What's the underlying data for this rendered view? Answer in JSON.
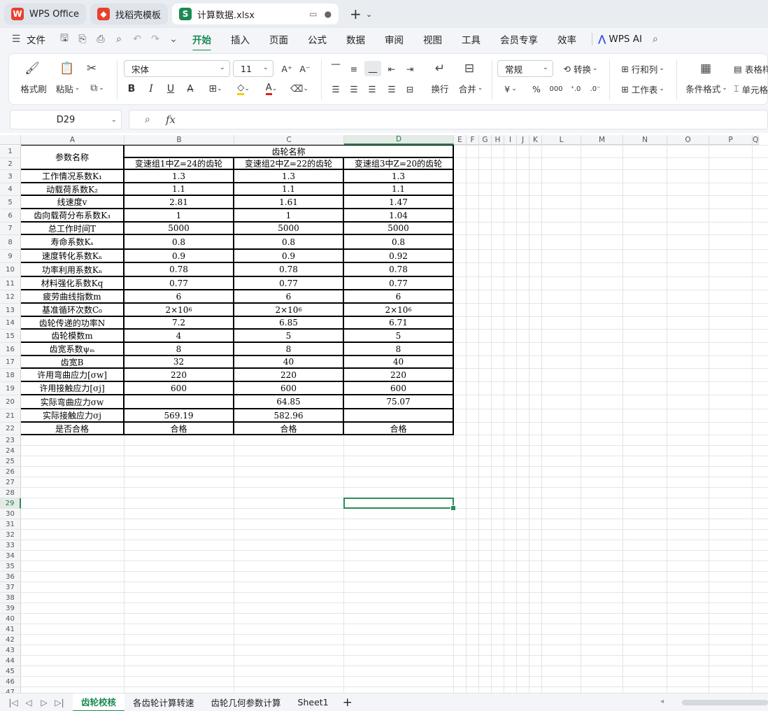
{
  "tabs": [
    {
      "label": "WPS Office",
      "icon": "wps-logo"
    },
    {
      "label": "找稻壳模板",
      "icon": "docer-logo"
    },
    {
      "label": "计算数据.xlsx",
      "icon": "spreadsheet-logo"
    }
  ],
  "menu": {
    "items": [
      "文件",
      "开始",
      "插入",
      "页面",
      "公式",
      "数据",
      "审阅",
      "视图",
      "工具",
      "会员专享",
      "效率"
    ],
    "active": "开始",
    "wps_ai": "WPS AI"
  },
  "ribbon": {
    "format_painter": "格式刷",
    "paste": "粘贴",
    "font_name": "宋体",
    "font_size": "11",
    "bold": "B",
    "italic": "I",
    "underline": "U",
    "wrap": "换行",
    "merge": "合并",
    "number_format": "常规",
    "convert": "转换",
    "row_col": "行和列",
    "worksheet": "工作表",
    "cond_format": "条件格式",
    "table_style": "表格样式",
    "cell": "单元格",
    "currency": "¥",
    "percent": "%"
  },
  "formula_bar": {
    "cell_ref": "D29",
    "fx": "fx",
    "content": ""
  },
  "columns": [
    "A",
    "B",
    "C",
    "D",
    "E",
    "F",
    "G",
    "H",
    "I",
    "J",
    "K",
    "L",
    "M",
    "N",
    "O",
    "P",
    "Q"
  ],
  "selected": {
    "col": "D",
    "row": "29"
  },
  "table": {
    "header_a": "参数名称",
    "header_group": "齿轮名称",
    "gears": [
      "变速组1中Z=24的齿轮",
      "变速组2中Z=22的齿轮",
      "变速组3中Z=20的齿轮"
    ],
    "rows": [
      {
        "name": "工作情况系数K₁",
        "b": "1.3",
        "c": "1.3",
        "d": "1.3"
      },
      {
        "name": "动载荷系数K₂",
        "b": "1.1",
        "c": "1.1",
        "d": "1.1"
      },
      {
        "name": "线速度v",
        "b": "2.81",
        "c": "1.61",
        "d": "1.47"
      },
      {
        "name": "齿向载荷分布系数K₃",
        "b": "1",
        "c": "1",
        "d": "1.04"
      },
      {
        "name": "总工作时间T",
        "b": "5000",
        "c": "5000",
        "d": "5000"
      },
      {
        "name": "寿命系数Kₛ",
        "b": "0.8",
        "c": "0.8",
        "d": "0.8"
      },
      {
        "name": "速度转化系数Kₙ",
        "b": "0.9",
        "c": "0.9",
        "d": "0.92"
      },
      {
        "name": "功率利用系数Kₙ",
        "b": "0.78",
        "c": "0.78",
        "d": "0.78"
      },
      {
        "name": "材料强化系数Kq",
        "b": "0.77",
        "c": "0.77",
        "d": "0.77"
      },
      {
        "name": "疲劳曲线指数m",
        "b": "6",
        "c": "6",
        "d": "6"
      },
      {
        "name": "基准循环次数C₀",
        "b": "2×10",
        "c": "2×10",
        "d": "2×10",
        "sup": "6"
      },
      {
        "name": "齿轮传递的功率N",
        "b": "7.2",
        "c": "6.85",
        "d": "6.71"
      },
      {
        "name": "齿轮模数m",
        "b": "4",
        "c": "5",
        "d": "5"
      },
      {
        "name": "齿宽系数ψₘ",
        "b": "8",
        "c": "8",
        "d": "8"
      },
      {
        "name": "齿宽B",
        "b": "32",
        "c": "40",
        "d": "40"
      },
      {
        "name": "许用弯曲应力[σw]",
        "b": "220",
        "c": "220",
        "d": "220"
      },
      {
        "name": "许用接触应力[σj]",
        "b": "600",
        "c": "600",
        "d": "600"
      },
      {
        "name": "实际弯曲应力σw",
        "b": "",
        "c": "64.85",
        "d": "75.07"
      },
      {
        "name": "实际接触应力σj",
        "b": "569.19",
        "c": "582.96",
        "d": ""
      },
      {
        "name": "是否合格",
        "b": "合格",
        "c": "合格",
        "d": "合格"
      }
    ]
  },
  "sheets": [
    "齿轮校核",
    "各齿轮计算转速",
    "齿轮几何参数计算",
    "Sheet1"
  ],
  "active_sheet": "齿轮校核"
}
